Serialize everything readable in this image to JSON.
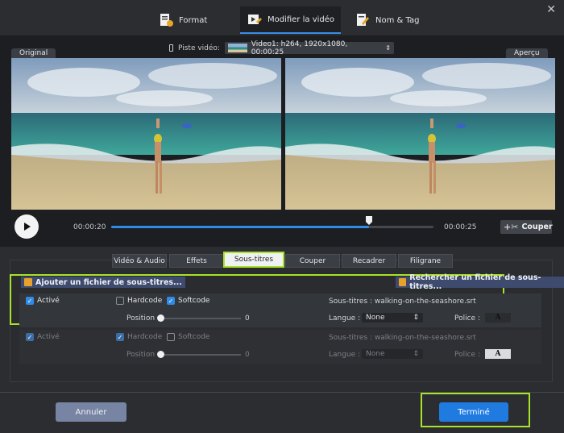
{
  "tabs": [
    {
      "label": "Format",
      "icon": "format-icon"
    },
    {
      "label": "Modifier la vidéo",
      "icon": "edit-video-icon"
    },
    {
      "label": "Nom & Tag",
      "icon": "name-tag-icon"
    }
  ],
  "close_glyph": "✕",
  "preview": {
    "original_label": "Original",
    "apercu_label": "Aperçu",
    "piste_label": "Piste vidéo:",
    "piste_value": "Video1: h264, 1920x1080, 00:00:25"
  },
  "playback": {
    "current_time": "00:00:20",
    "total_time": "00:00:25",
    "progress": 0.8,
    "cut_label": "Couper"
  },
  "sub_tabs": [
    "Vidéo  & Audio",
    "Effets",
    "Sous-titres",
    "Couper",
    "Recadrer",
    "Filigrane"
  ],
  "subtitles": {
    "add_file_label": "Ajouter un fichier de sous-titres...",
    "search_file_label": "Rechercher un fichier de sous-titres...",
    "rows": [
      {
        "active_label": "Activé",
        "hardcode_label": "Hardcode",
        "softcode_label": "Softcode",
        "active": true,
        "hardcode": false,
        "softcode": true,
        "position_label": "Position :",
        "position_value": "0",
        "subtitle_text": "Sous-titres : walking-on-the-seashore.srt",
        "language_label": "Langue :",
        "language_value": "None",
        "font_label": "Police :",
        "font_glyph": "A"
      },
      {
        "active_label": "Activé",
        "hardcode_label": "Hardcode",
        "softcode_label": "Softcode",
        "active": true,
        "hardcode": true,
        "softcode": false,
        "position_label": "Position :",
        "position_value": "0",
        "subtitle_text": "Sous-titres : walking-on-the-seashore.srt",
        "language_label": "Langue :",
        "language_value": "None",
        "font_label": "Police :",
        "font_glyph": "A"
      }
    ]
  },
  "footer": {
    "cancel_label": "Annuler",
    "done_label": "Terminé"
  },
  "colors": {
    "accent": "#2f8be6",
    "highlight": "#a9e22a"
  }
}
